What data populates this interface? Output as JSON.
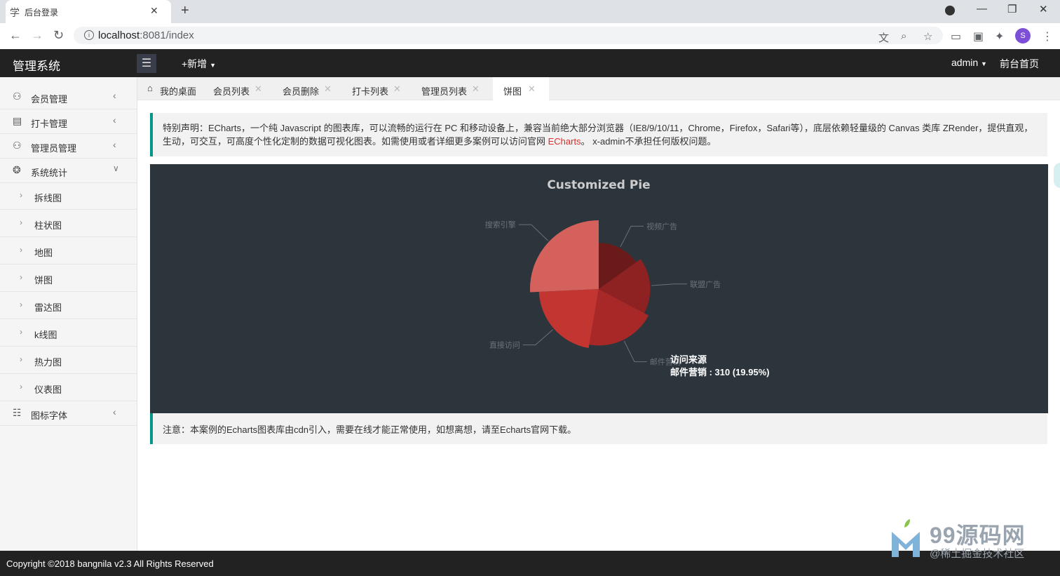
{
  "browser": {
    "tab_title": "后台登录",
    "tab_icon": "graduation-cap-icon",
    "url_host": "localhost",
    "url_rest": ":8081/index",
    "profile_initial": "S"
  },
  "header": {
    "brand": "管理系统",
    "add_new": "+新增",
    "admin": "admin",
    "home": "前台首页"
  },
  "sidebar": {
    "items": [
      {
        "label": "会员管理",
        "icon": "user-icon"
      },
      {
        "label": "打卡管理",
        "icon": "clipboard-icon"
      },
      {
        "label": "管理员管理",
        "icon": "user-icon"
      },
      {
        "label": "系统统计",
        "icon": "chart-icon"
      }
    ],
    "sub_items": [
      "拆线图",
      "柱状图",
      "地图",
      "饼图",
      "雷达图",
      "k线图",
      "热力图",
      "仪表图"
    ],
    "last_item": {
      "label": "图标字体",
      "icon": "grid-icon"
    }
  },
  "tabs": {
    "home": "我的桌面",
    "items": [
      "会员列表",
      "会员删除",
      "打卡列表",
      "管理员列表",
      "饼图"
    ],
    "active": "饼图"
  },
  "notice": {
    "text1": "特别声明：ECharts，一个纯 Javascript 的图表库，可以流畅的运行在 PC 和移动设备上，兼容当前绝大部分浏览器（IE8/9/10/11，Chrome，Firefox，Safari等），底层依赖轻量级的 Canvas 类库 ZRender，提供直观，生动，可交互，可高度个性化定制的数据可视化图表。如需使用或者详细更多案例可以访问官网 ",
    "link": "ECharts",
    "text2": "。 x-admin不承担任何版权问题。"
  },
  "chart_data": {
    "type": "pie",
    "title": "Customized Pie",
    "series_name": "访问来源",
    "categories": [
      "视频广告",
      "联盟广告",
      "邮件营销",
      "直接访问",
      "搜索引擎"
    ],
    "values": [
      235,
      274,
      310,
      335,
      400
    ],
    "colors": [
      "#6b1a1a",
      "#8e2222",
      "#a82828",
      "#c23531",
      "#d4615c"
    ],
    "background": "#2c343c",
    "roseType": "radius",
    "tooltip": "邮件营销 : 310 (19.95%)"
  },
  "note2": "注意：本案例的Echarts图表库由cdn引入，需要在线才能正常使用，如想离想，请至Echarts官网下载。",
  "footer": "Copyright ©2018 bangnila v2.3 All Rights Reserved",
  "watermark": {
    "title": "99源码网",
    "subtitle": "@稀土掘金技术社区"
  }
}
